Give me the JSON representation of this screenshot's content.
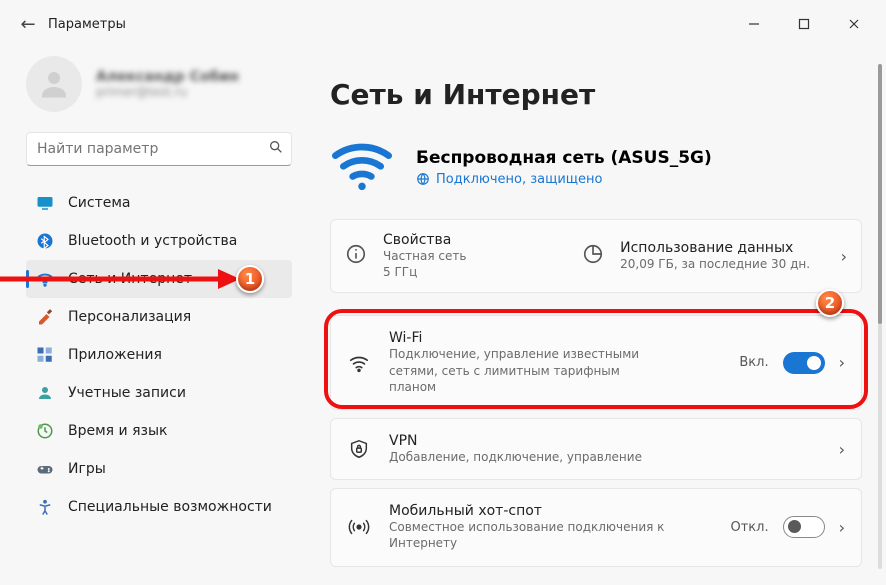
{
  "window": {
    "title": "Параметры"
  },
  "profile": {
    "name": "Александр Собин",
    "email": "primer@test.ru"
  },
  "search": {
    "placeholder": "Найти параметр"
  },
  "sidebar": {
    "items": [
      {
        "label": "Система",
        "icon": "system-icon",
        "color": "#1890c9"
      },
      {
        "label": "Bluetooth и устройства",
        "icon": "bluetooth-icon",
        "color": "#1976d2"
      },
      {
        "label": "Сеть и Интернет",
        "icon": "wifi-icon",
        "color": "#1976d2",
        "selected": true
      },
      {
        "label": "Персонализация",
        "icon": "brush-icon",
        "color": "#d85a2a"
      },
      {
        "label": "Приложения",
        "icon": "apps-icon",
        "color": "#3a6fb7"
      },
      {
        "label": "Учетные записи",
        "icon": "account-icon",
        "color": "#3aa0a0"
      },
      {
        "label": "Время и язык",
        "icon": "clock-icon",
        "color": "#4a9a4a"
      },
      {
        "label": "Игры",
        "icon": "game-icon",
        "color": "#5a6b7a"
      },
      {
        "label": "Специальные возможности",
        "icon": "accessibility-icon",
        "color": "#3a6fb7"
      }
    ]
  },
  "page": {
    "title": "Сеть и Интернет"
  },
  "hero": {
    "name": "Беспроводная сеть (ASUS_5G)",
    "status": "Подключено, защищено"
  },
  "summary": {
    "properties": {
      "title": "Свойства",
      "line1": "Частная сеть",
      "line2": "5 ГГц"
    },
    "usage": {
      "title": "Использование данных",
      "line1": "20,09 ГБ, за последние 30 дн."
    }
  },
  "cards": {
    "wifi": {
      "title": "Wi-Fi",
      "sub": "Подключение, управление известными сетями, сеть с лимитным тарифным планом",
      "tail_label": "Вкл.",
      "toggle_on": true
    },
    "vpn": {
      "title": "VPN",
      "sub": "Добавление, подключение, управление"
    },
    "hotspot": {
      "title": "Мобильный хот-спот",
      "sub": "Совместное использование подключения к Интернету",
      "tail_label": "Откл.",
      "toggle_on": false
    }
  },
  "markers": {
    "m1": "1",
    "m2": "2"
  }
}
